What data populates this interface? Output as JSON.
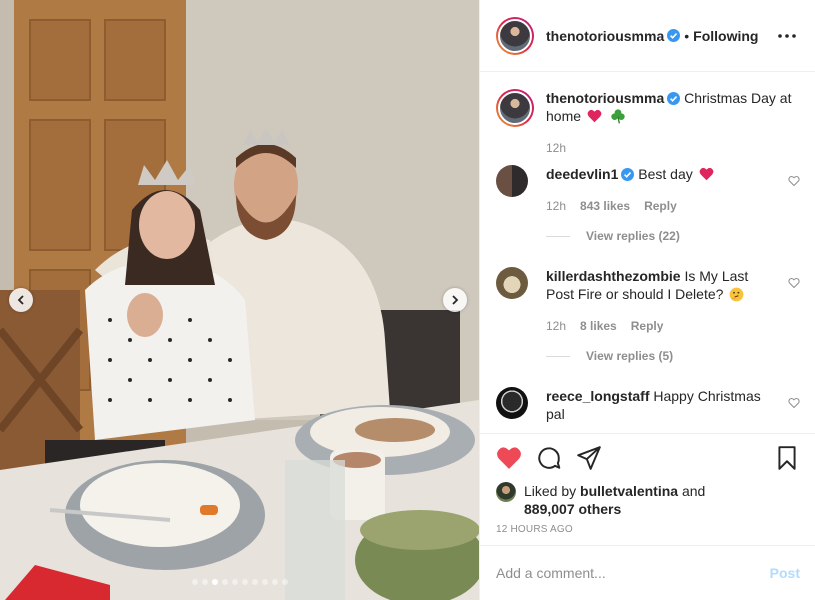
{
  "post": {
    "username": "thenotoriousmma",
    "follow_status": "Following",
    "caption": {
      "username": "thenotoriousmma",
      "text": "Christmas Day at home",
      "emojis": [
        "red-heart-icon",
        "shamrock-icon"
      ],
      "time": "12h"
    }
  },
  "comments": [
    {
      "username": "deedevlin1",
      "verified": true,
      "text": "Best day",
      "emoji": "red-heart-icon",
      "time": "12h",
      "likes": "843 likes",
      "reply": "Reply",
      "view_replies": "View replies (22)"
    },
    {
      "username": "killerdashthezombie",
      "verified": false,
      "text": "Is My Last Post Fire or should I Delete?",
      "emoji": "thinking-face-icon",
      "time": "12h",
      "likes": "8 likes",
      "reply": "Reply",
      "view_replies": "View replies (5)"
    },
    {
      "username": "reece_longstaff",
      "verified": false,
      "text": "Happy Christmas pal"
    }
  ],
  "actions": {
    "liked_prefix": "Liked by",
    "liked_user": "bulletvalentina",
    "liked_and": "and",
    "liked_others": "889,007 others",
    "time_ago": "12 HOURS AGO"
  },
  "add_comment": {
    "placeholder": "Add a comment...",
    "post_label": "Post"
  },
  "carousel": {
    "dot_count": 10,
    "active_index": 2
  },
  "colors": {
    "like_red": "#ed4956",
    "verified_blue": "#3897f0",
    "post_disabled": "#b3dbff"
  }
}
